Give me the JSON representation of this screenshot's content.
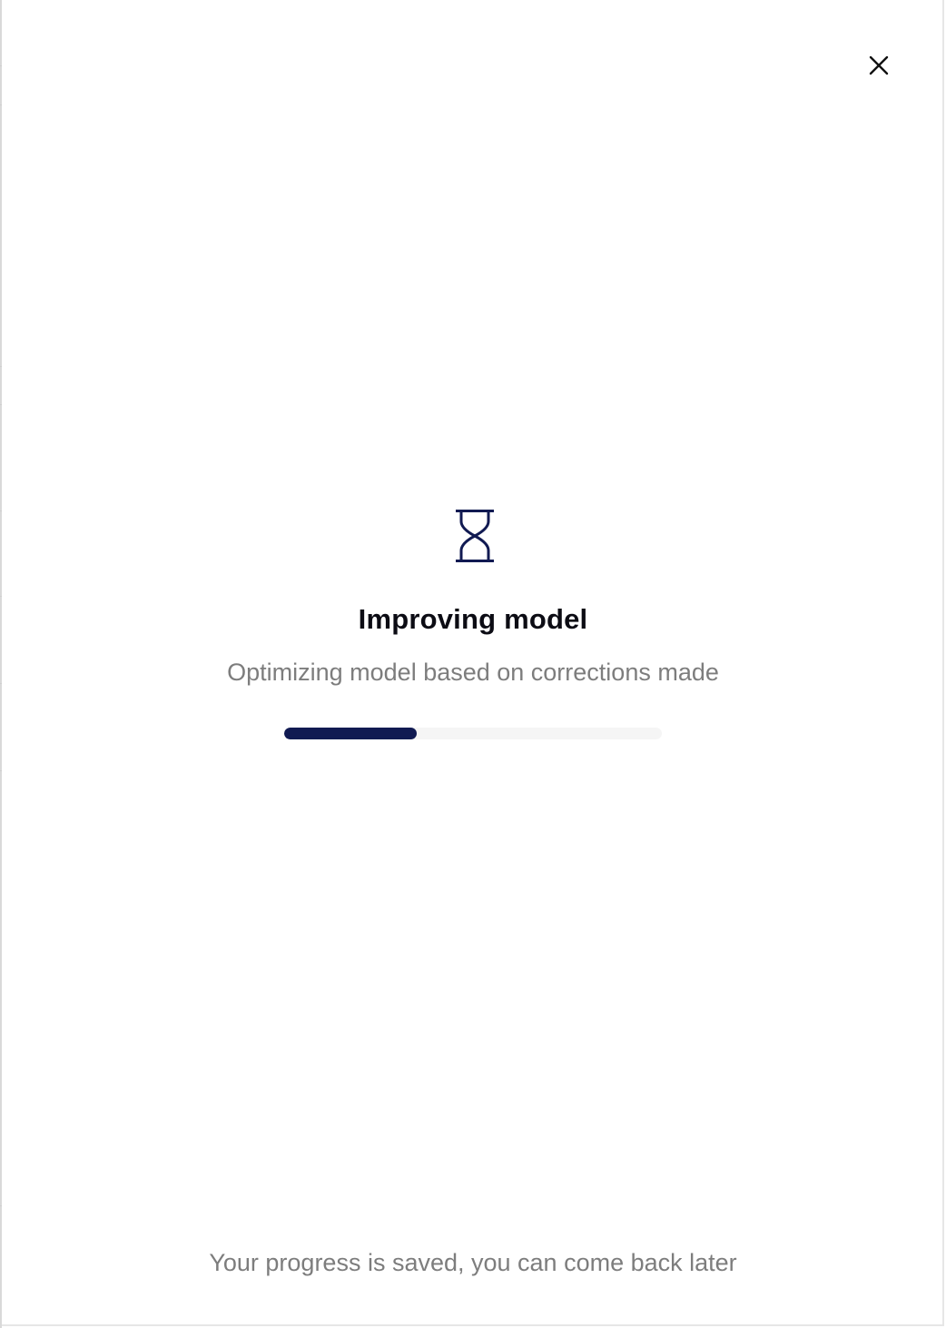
{
  "modal": {
    "title": "Improving model",
    "subtitle": "Optimizing model based on corrections made",
    "progress": 0.35,
    "footer_note": "Your progress is saved, you can come back later",
    "icons": {
      "status": "hourglass-icon",
      "close": "close-icon"
    }
  },
  "colors": {
    "accent": "#111a52",
    "title": "#0c0c14",
    "muted_text": "#7d7d7d",
    "track": "#f5f5f5"
  }
}
